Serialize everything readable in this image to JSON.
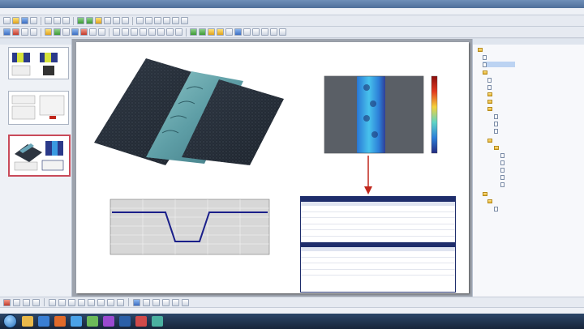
{
  "window": {
    "title": ""
  },
  "menu": [],
  "left_panel": {
    "title": ""
  },
  "right_panel": {
    "title": ""
  },
  "tree": [],
  "table": {
    "header1": "",
    "header2": "",
    "rows1": [],
    "rows2": []
  },
  "status": {
    "text": ""
  },
  "clock": {
    "time": "",
    "date": ""
  },
  "colors": {
    "report_header": "#1e2d6b",
    "profile_line": "#1a1f8a",
    "plot_bg": "#d7d7d7",
    "arrow": "#c0271c",
    "selected_thumb_border": "#c94a5a"
  }
}
